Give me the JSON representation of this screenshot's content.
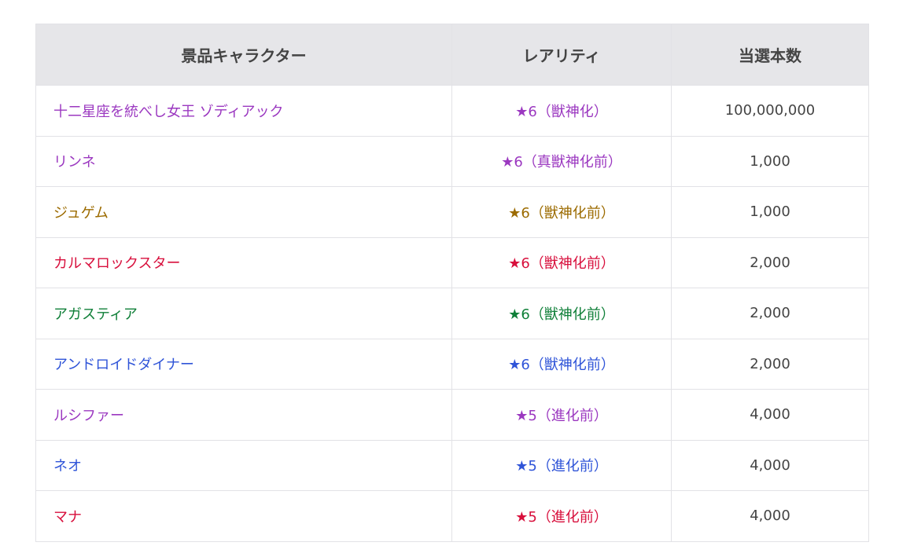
{
  "headers": {
    "character": "景品キャラクター",
    "rarity": "レアリティ",
    "count": "当選本数"
  },
  "colors": {
    "purple": "#9b38c0",
    "gold": "#9c6b00",
    "red": "#d80f3c",
    "green": "#0f7f38",
    "blue": "#2f54d8",
    "text": "#444444"
  },
  "rows": [
    {
      "name": "十二星座を統べし女王 ゾディアック",
      "rarity": "★6（獣神化）",
      "count": "100,000,000",
      "color": "#9b38c0"
    },
    {
      "name": "リンネ",
      "rarity": "★6（真獣神化前）",
      "count": "1,000",
      "color": "#9b38c0"
    },
    {
      "name": "ジュゲム",
      "rarity": "★6（獣神化前）",
      "count": "1,000",
      "color": "#9c6b00"
    },
    {
      "name": "カルマロックスター",
      "rarity": "★6（獣神化前）",
      "count": "2,000",
      "color": "#d80f3c"
    },
    {
      "name": "アガスティア",
      "rarity": "★6（獣神化前）",
      "count": "2,000",
      "color": "#0f7f38"
    },
    {
      "name": "アンドロイドダイナー",
      "rarity": "★6（獣神化前）",
      "count": "2,000",
      "color": "#2f54d8"
    },
    {
      "name": "ルシファー",
      "rarity": "★5（進化前）",
      "count": "4,000",
      "color": "#9b38c0"
    },
    {
      "name": "ネオ",
      "rarity": "★5（進化前）",
      "count": "4,000",
      "color": "#2f54d8"
    },
    {
      "name": "マナ",
      "rarity": "★5（進化前）",
      "count": "4,000",
      "color": "#d80f3c"
    }
  ]
}
